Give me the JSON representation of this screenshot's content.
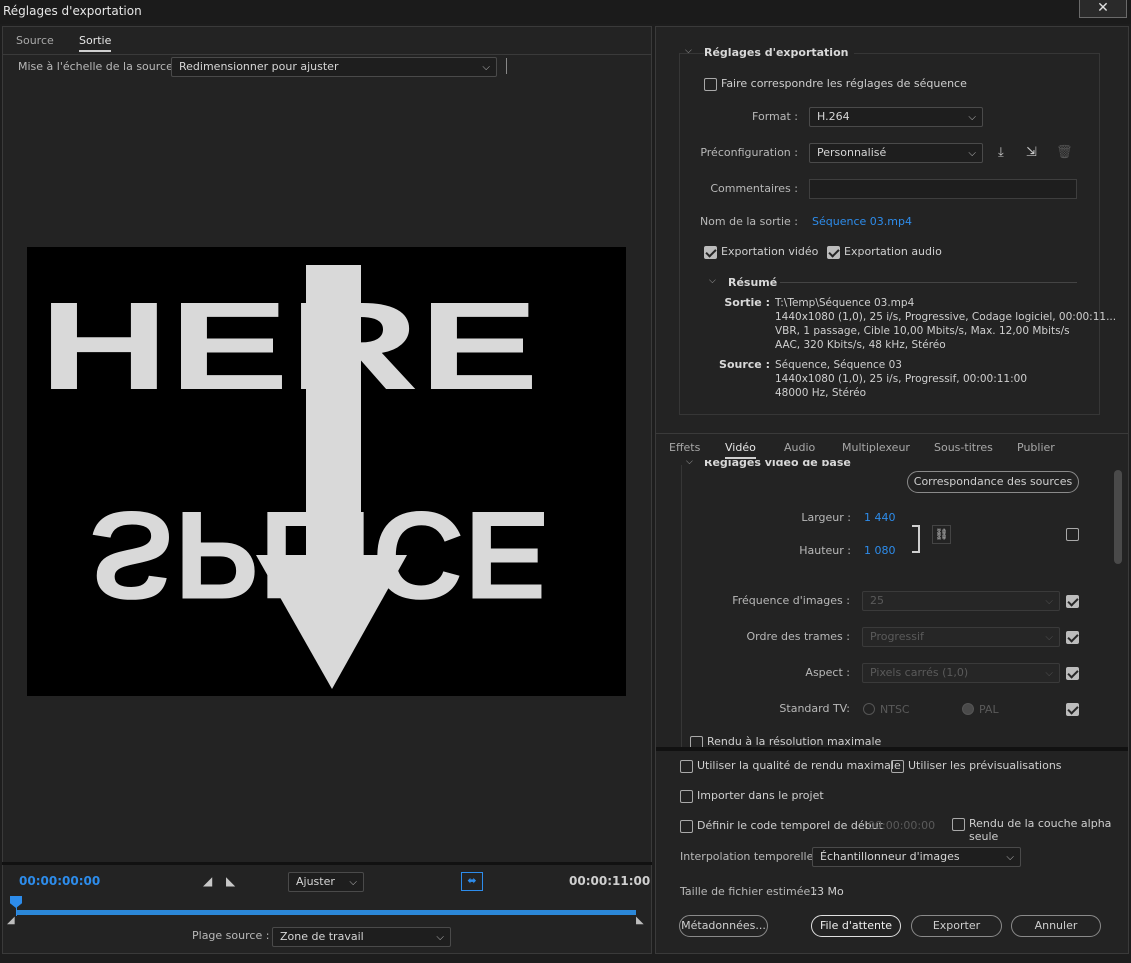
{
  "window": {
    "title": "Réglages d'exportation",
    "close_icon": "✕"
  },
  "left": {
    "tabs": [
      {
        "label": "Source"
      },
      {
        "label": "Sortie"
      }
    ],
    "scale_label": "Mise à l'échelle de la source :",
    "scale_value": "Redimensionner pour ajuster",
    "preview": {
      "top_text": "HERE",
      "bottom_text": "SPLICE"
    },
    "timeline": {
      "current": "00:00:00:00",
      "end": "00:00:11:00",
      "fit_value": "Ajuster",
      "range_label": "Plage source :",
      "range_value": "Zone de travail"
    }
  },
  "export": {
    "section_title": "Réglages d'exportation",
    "match_seq_label": "Faire correspondre les réglages de séquence",
    "format_label": "Format :",
    "format_value": "H.264",
    "preset_label": "Préconfiguration :",
    "preset_value": "Personnalisé",
    "comments_label": "Commentaires :",
    "comments_value": "",
    "output_name_label": "Nom de la sortie :",
    "output_name_value": "Séquence 03.mp4",
    "export_video_label": "Exportation vidéo",
    "export_audio_label": "Exportation audio",
    "summary": {
      "title": "Résumé",
      "output_label": "Sortie :",
      "output_lines": [
        "T:\\Temp\\Séquence 03.mp4",
        "1440x1080 (1,0), 25 i/s, Progressive, Codage logiciel, 00:00:11...",
        "VBR, 1 passage, Cible 10,00  Mbits/s, Max. 12,00  Mbits/s",
        "AAC, 320  Kbits/s, 48  kHz, Stéréo"
      ],
      "source_label": "Source :",
      "source_lines": [
        "Séquence, Séquence 03",
        "1440x1080 (1,0), 25  i/s, Progressif, 00:00:11:00",
        "48000 Hz, Stéréo"
      ]
    }
  },
  "tabs2": [
    {
      "label": "Effets"
    },
    {
      "label": "Vidéo"
    },
    {
      "label": "Audio"
    },
    {
      "label": "Multiplexeur"
    },
    {
      "label": "Sous-titres"
    },
    {
      "label": "Publier"
    }
  ],
  "video": {
    "section_title": "Réglages vidéo de base",
    "match_sources_btn": "Correspondance des sources",
    "width_label": "Largeur :",
    "width_value": "1 440",
    "height_label": "Hauteur :",
    "height_value": "1 080",
    "fps_label": "Fréquence d'images :",
    "fps_value": "25",
    "field_label": "Ordre des trames :",
    "field_value": "Progressif",
    "aspect_label": "Aspect :",
    "aspect_value": "Pixels carrés (1,0)",
    "tv_label": "Standard TV:",
    "ntsc": "NTSC",
    "pal": "PAL",
    "max_res_label": "Rendu à la résolution maximale"
  },
  "bottom": {
    "max_quality_label": "Utiliser la qualité de rendu maximale",
    "use_previews_label": "Utiliser les prévisualisations",
    "import_label": "Importer dans le projet",
    "timecode_label": "Définir le code temporel de début",
    "timecode_value": "00:00:00:00",
    "alpha_label": "Rendu de la couche alpha seule",
    "interp_label": "Interpolation temporelle :",
    "interp_value": "Échantillonneur d'images",
    "filesize_label": "Taille de fichier estimée :",
    "filesize_value": "13 Mo",
    "metadata_btn": "Métadonnées...",
    "queue_btn": "File d'attente",
    "export_btn": "Exporter",
    "cancel_btn": "Annuler"
  },
  "colors": {
    "accent": "#2d8ceb",
    "panel": "#232323"
  }
}
